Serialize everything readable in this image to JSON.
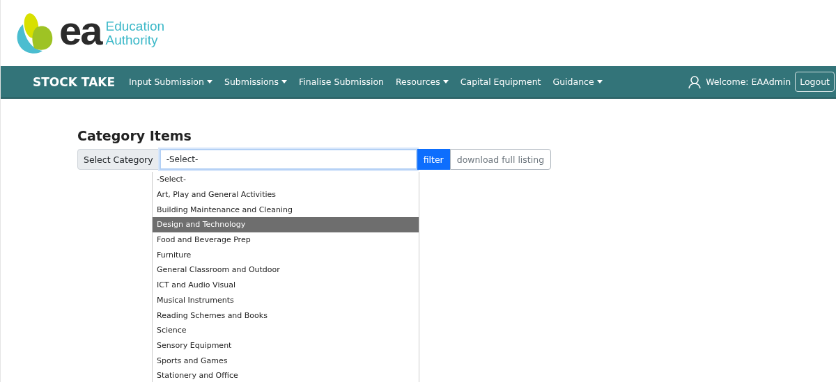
{
  "logo": {
    "mark": "ea",
    "line1": "Education",
    "line2": "Authority"
  },
  "navbar": {
    "brand": "STOCK TAKE",
    "items": [
      {
        "label": "Input Submission",
        "dropdown": true
      },
      {
        "label": "Submissions",
        "dropdown": true
      },
      {
        "label": "Finalise Submission",
        "dropdown": false
      },
      {
        "label": "Resources",
        "dropdown": true
      },
      {
        "label": "Capital Equipment",
        "dropdown": false
      },
      {
        "label": "Guidance",
        "dropdown": true
      }
    ],
    "welcome": "Welcome: EAAdmin",
    "logout": "Logout"
  },
  "page": {
    "title": "Category Items",
    "select_label": "Select Category",
    "select_value": "-Select-",
    "filter_button": "filter",
    "download_button": "download full listing",
    "options": [
      {
        "label": "-Select-",
        "selected": false
      },
      {
        "label": "Art, Play and General Activities",
        "selected": false
      },
      {
        "label": "Building Maintenance and Cleaning",
        "selected": false
      },
      {
        "label": "Design and Technology",
        "selected": true
      },
      {
        "label": "Food and Beverage Prep",
        "selected": false
      },
      {
        "label": "Furniture",
        "selected": false
      },
      {
        "label": "General Classroom and Outdoor",
        "selected": false
      },
      {
        "label": "ICT and Audio Visual",
        "selected": false
      },
      {
        "label": "Musical Instruments",
        "selected": false
      },
      {
        "label": "Reading Schemes and Books",
        "selected": false
      },
      {
        "label": "Science",
        "selected": false
      },
      {
        "label": "Sensory Equipment",
        "selected": false
      },
      {
        "label": "Sports and Games",
        "selected": false
      },
      {
        "label": "Stationery and Office",
        "selected": false
      }
    ]
  }
}
